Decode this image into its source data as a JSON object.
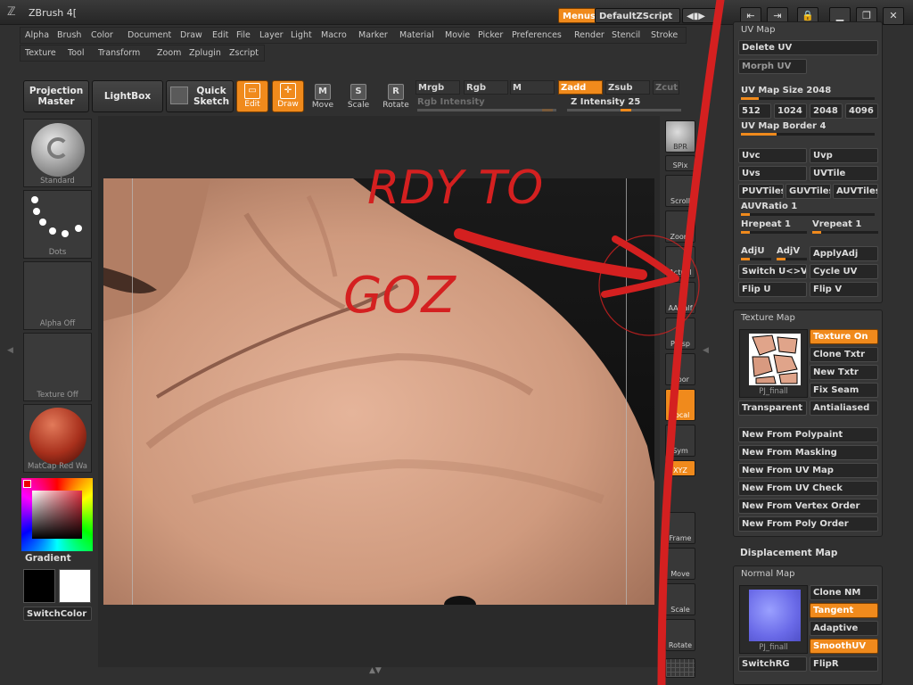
{
  "window": {
    "title": "ZBrush 4[",
    "menus_button": "Menus",
    "script_button": "DefaultZScript"
  },
  "menus": {
    "row1": [
      "Alpha",
      "Brush",
      "Color",
      "Document",
      "Draw",
      "Edit",
      "File",
      "Layer",
      "Light",
      "Macro",
      "Marker",
      "Material",
      "Movie",
      "Picker",
      "Preferences",
      "Render",
      "Stencil",
      "Stroke"
    ],
    "row2": [
      "Texture",
      "Tool",
      "Transform",
      "Zoom",
      "Zplugin",
      "Zscript"
    ]
  },
  "toolbar": {
    "projection_master": "Projection Master",
    "lightbox": "LightBox",
    "quick_sketch": "Quick Sketch",
    "edit": "Edit",
    "draw": "Draw",
    "move": "Move",
    "scale": "Scale",
    "rotate": "Rotate",
    "mrgb": "Mrgb",
    "rgb": "Rgb",
    "m": "M",
    "zadd": "Zadd",
    "zsub": "Zsub",
    "zcut": "Zcut",
    "rgb_intensity": "Rgb Intensity",
    "z_intensity": "Z Intensity 25"
  },
  "left_shelf": {
    "brush": "Standard",
    "stroke": "Dots",
    "alpha": "Alpha Off",
    "texture": "Texture Off",
    "material": "MatCap Red Wa",
    "gradient": "Gradient",
    "switch_color": "SwitchColor"
  },
  "right_shelf": [
    "BPR",
    "SPix",
    "Scroll",
    "Zoom",
    "Actual",
    "AAHalf",
    "Persp",
    "Floor",
    "Local",
    "Sym",
    "XYZ",
    "Frame",
    "Move",
    "Scale",
    "Rotate"
  ],
  "uv_map": {
    "title": "UV Map",
    "delete_uv": "Delete UV",
    "morph_uv": "Morph UV",
    "size_label": "UV Map Size 2048",
    "sizes": [
      "512",
      "1024",
      "2048",
      "4096"
    ],
    "border_label": "UV Map Border 4",
    "uvc": "Uvc",
    "uvp": "Uvp",
    "uvs": "Uvs",
    "uvtile": "UVTile",
    "puvtiles": "PUVTiles",
    "guvtiles": "GUVTiles",
    "auvtiles": "AUVTiles",
    "auvratio": "AUVRatio 1",
    "hrepeat": "Hrepeat 1",
    "vrepeat": "Vrepeat 1",
    "adju": "AdjU",
    "adjv": "AdjV",
    "applyadj": "ApplyAdj",
    "switch_uv": "Switch U<>V",
    "cycle_uv": "Cycle UV",
    "flip_u": "Flip U",
    "flip_v": "Flip V"
  },
  "texture_map": {
    "title": "Texture Map",
    "thumb_label": "PJ_finall",
    "texture_on": "Texture On",
    "clone_txtr": "Clone Txtr",
    "new_txtr": "New Txtr",
    "fix_seam": "Fix Seam",
    "transparent": "Transparent",
    "antialiased": "Antialiased",
    "new_from": [
      "New From Polypaint",
      "New From Masking",
      "New From UV Map",
      "New From UV Check",
      "New From Vertex Order",
      "New From Poly Order"
    ]
  },
  "displacement_map": {
    "title": "Displacement Map"
  },
  "normal_map": {
    "title": "Normal Map",
    "thumb_label": "PJ_finall",
    "clone_nm": "Clone NM",
    "tangent": "Tangent",
    "adaptive": "Adaptive",
    "smoothuv": "SmoothUV",
    "switchrg": "SwitchRG",
    "flipr": "FlipR"
  },
  "annotation": {
    "line1": "RDY TO",
    "line2": "GOZ",
    "color": "#d42020"
  },
  "colors": {
    "accent": "#f08a1c",
    "skin": "#d9a488",
    "annotation_red": "#d42020"
  }
}
